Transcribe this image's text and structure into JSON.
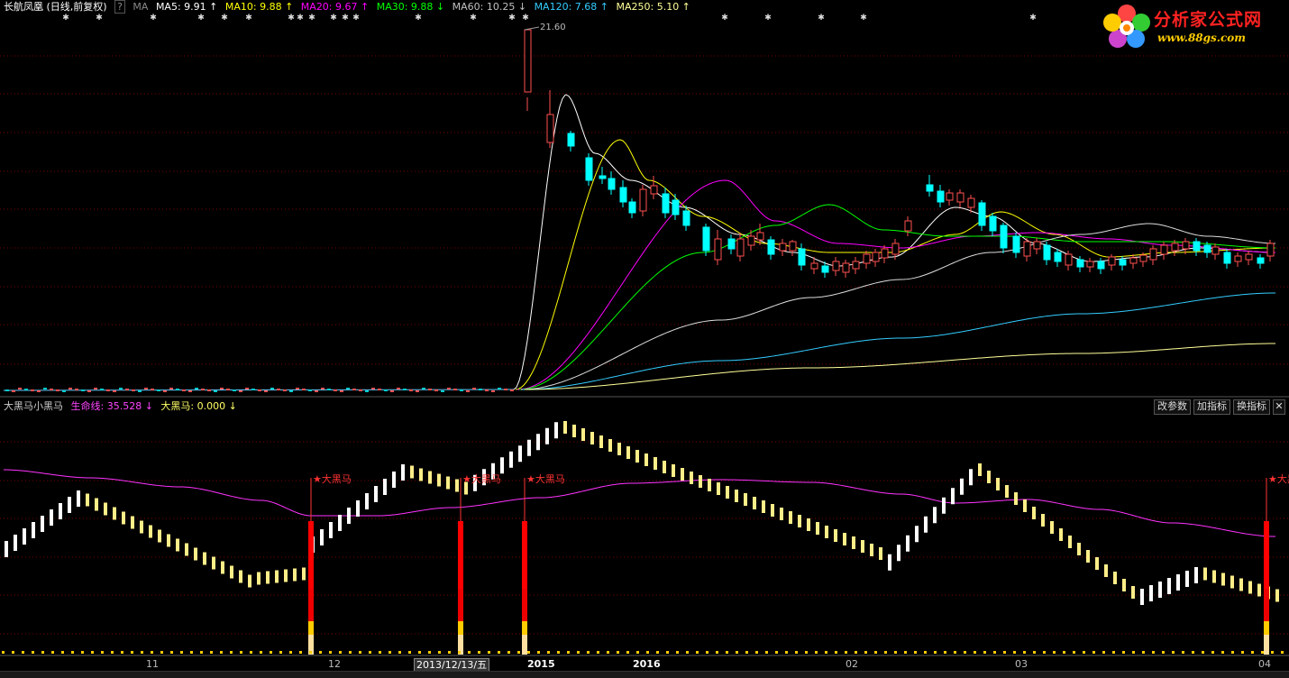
{
  "header": {
    "title": "长航凤凰 (日线,前复权)",
    "help": "?",
    "ma_label": "MA",
    "ma_items": [
      {
        "text": "MA5: 9.91 ↑",
        "color": "#ffffff"
      },
      {
        "text": "MA10: 9.88 ↑",
        "color": "#ffff00"
      },
      {
        "text": "MA20: 9.67 ↑",
        "color": "#ff00ff"
      },
      {
        "text": "MA30: 9.88 ↓",
        "color": "#00ff00"
      },
      {
        "text": "MA60: 10.25 ↓",
        "color": "#c0c0c0"
      },
      {
        "text": "MA120: 7.68 ↑",
        "color": "#33ccff"
      },
      {
        "text": "MA250: 5.10 ↑",
        "color": "#ffff99"
      }
    ]
  },
  "peak_label": "21.60",
  "logo": {
    "line1": "分析家公式网",
    "line2": "www.88gs.com"
  },
  "indicator": {
    "name": "大黑马小黑马",
    "items": [
      {
        "text": "生命线: 35.528 ↓",
        "color": "#ff44ff"
      },
      {
        "text": "大黑马: 0.000 ↓",
        "color": "#ffff66"
      }
    ],
    "signal_label": "★大黑马",
    "buttons": {
      "params": "改参数",
      "add": "加指标",
      "switch": "换指标",
      "close": "✕"
    }
  },
  "xaxis": {
    "labels": [
      {
        "text": "11",
        "bold": false
      },
      {
        "text": "12",
        "bold": false
      },
      {
        "text": "2015",
        "bold": true
      },
      {
        "text": "2016",
        "bold": true
      },
      {
        "text": "02",
        "bold": false
      },
      {
        "text": "03",
        "bold": false
      },
      {
        "text": "04",
        "bold": false
      }
    ],
    "cursor_date": "2013/12/13/五"
  },
  "colors": {
    "up": "#ff5050",
    "down": "#00ffff",
    "grid": "#8b0000"
  }
}
